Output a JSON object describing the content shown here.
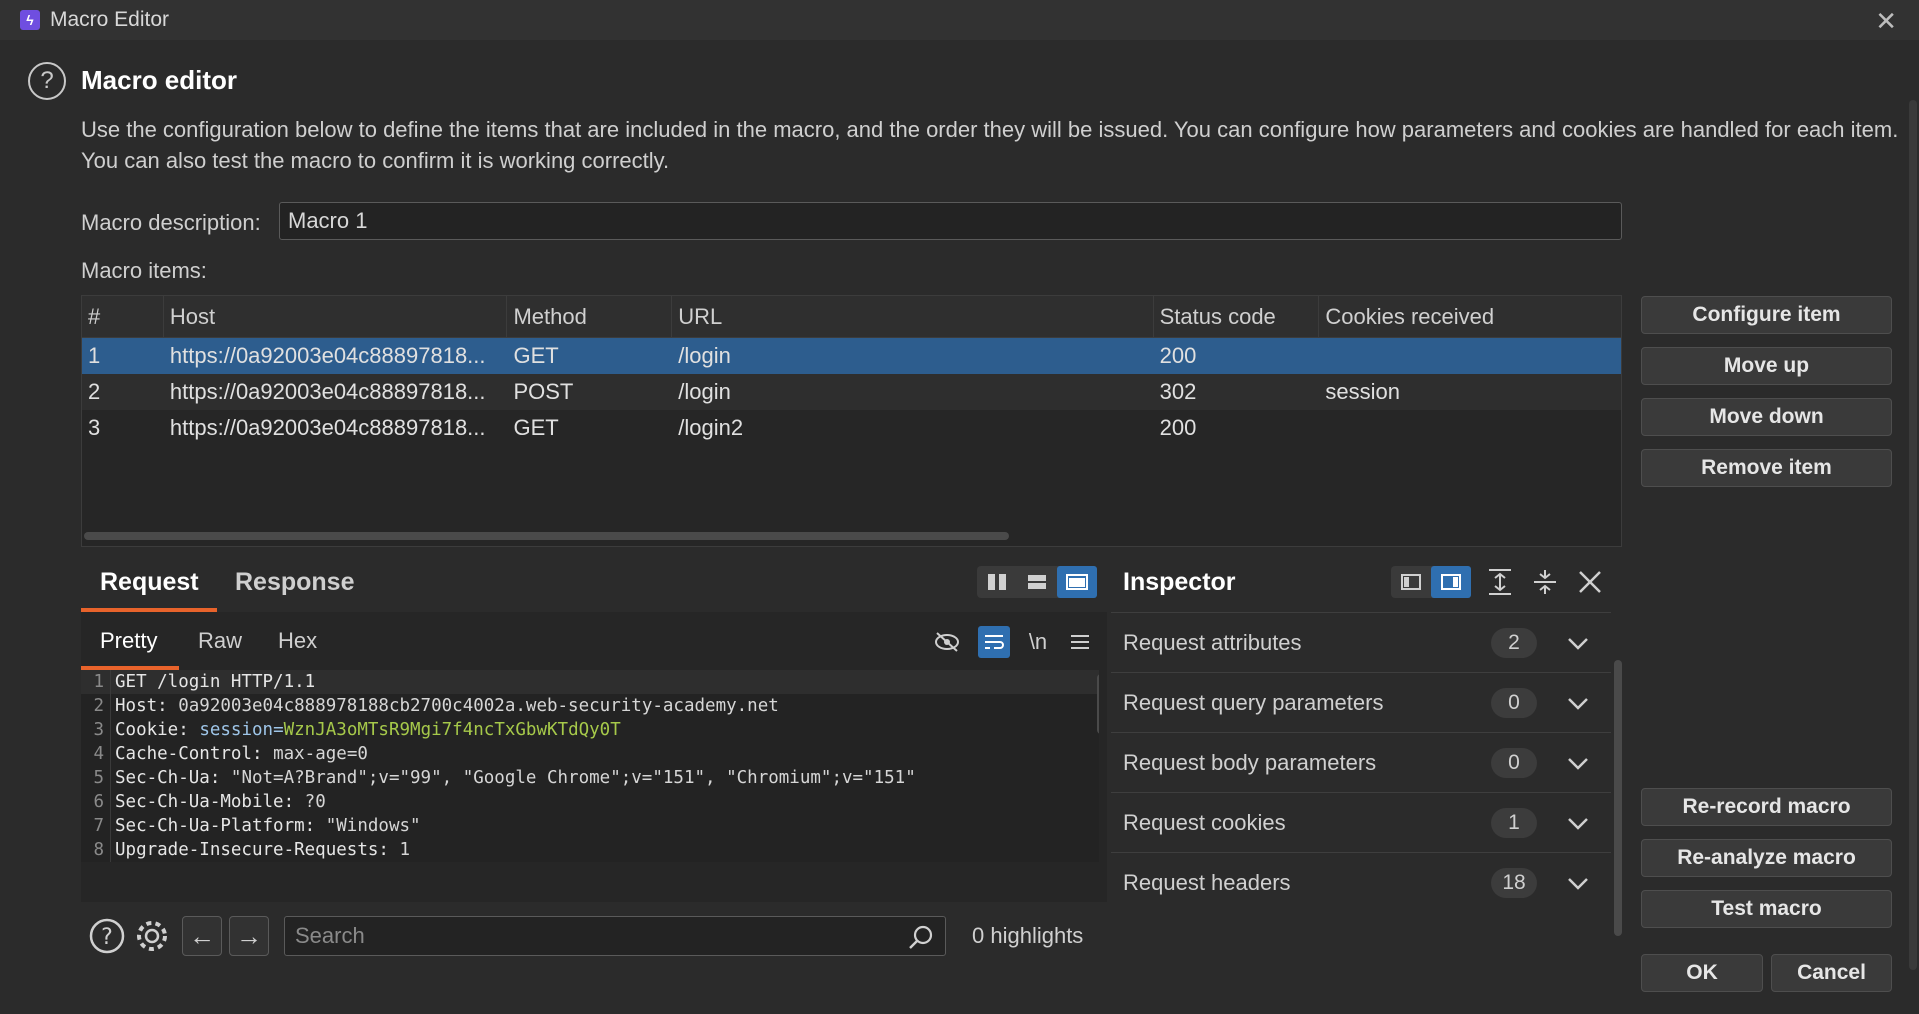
{
  "window": {
    "title": "Macro Editor"
  },
  "header": {
    "title": "Macro editor",
    "description": "Use the configuration below to define the items that are included in the macro, and the order they will be issued. You can configure how parameters and cookies are handled for each item. You can also test the macro to confirm it is working correctly."
  },
  "macro": {
    "description_label": "Macro description:",
    "description_value": "Macro 1",
    "items_label": "Macro items:"
  },
  "table": {
    "columns": [
      "#",
      "Host",
      "Method",
      "URL",
      "Status code",
      "Cookies received"
    ],
    "rows": [
      [
        "1",
        "https://0a92003e04c88897818...",
        "GET",
        "/login",
        "200",
        ""
      ],
      [
        "2",
        "https://0a92003e04c88897818...",
        "POST",
        "/login",
        "302",
        "session"
      ],
      [
        "3",
        "https://0a92003e04c88897818...",
        "GET",
        "/login2",
        "200",
        ""
      ]
    ],
    "selected_row": 1
  },
  "side_buttons": {
    "configure": "Configure item",
    "move_up": "Move up",
    "move_down": "Move down",
    "remove": "Remove item",
    "rerecord": "Re-record macro",
    "reanalyze": "Re-analyze macro",
    "test": "Test macro"
  },
  "request_panel": {
    "tabs": [
      "Request",
      "Response"
    ],
    "active_tab": "Request",
    "subtabs": [
      "Pretty",
      "Raw",
      "Hex"
    ],
    "active_subtab": "Pretty",
    "newline_toggle": "\\n",
    "lines": [
      {
        "n": "1",
        "key": "GET /login HTTP/1.1",
        "value": ""
      },
      {
        "n": "2",
        "key": "Host:",
        "value": "0a92003e04c888978188cb2700c4002a.web-security-academy.net"
      },
      {
        "n": "3",
        "key": "Cookie:",
        "cookie_name": "session=",
        "value": "WznJA3oMTsR9Mgi7f4ncTxGbwKTdQy0T"
      },
      {
        "n": "4",
        "key": "Cache-Control:",
        "value": "max-age=0"
      },
      {
        "n": "5",
        "key": "Sec-Ch-Ua:",
        "value": "\"Not=A?Brand\";v=\"99\", \"Google Chrome\";v=\"151\", \"Chromium\";v=\"151\""
      },
      {
        "n": "6",
        "key": "Sec-Ch-Ua-Mobile:",
        "value": "?0"
      },
      {
        "n": "7",
        "key": "Sec-Ch-Ua-Platform:",
        "value": "\"Windows\""
      },
      {
        "n": "8",
        "key": "Upgrade-Insecure-Requests:",
        "value": "1"
      }
    ],
    "search_placeholder": "Search",
    "highlights": "0 highlights"
  },
  "inspector": {
    "title": "Inspector",
    "rows": [
      {
        "label": "Request attributes",
        "count": "2"
      },
      {
        "label": "Request query parameters",
        "count": "0"
      },
      {
        "label": "Request body parameters",
        "count": "0"
      },
      {
        "label": "Request cookies",
        "count": "1"
      },
      {
        "label": "Request headers",
        "count": "18"
      }
    ]
  },
  "footer": {
    "ok": "OK",
    "cancel": "Cancel"
  },
  "colors": {
    "accent": "#e8632b",
    "selection": "#2d5d8e",
    "toggle_on": "#2f6fb0",
    "cookie_value": "#a6c94a"
  }
}
